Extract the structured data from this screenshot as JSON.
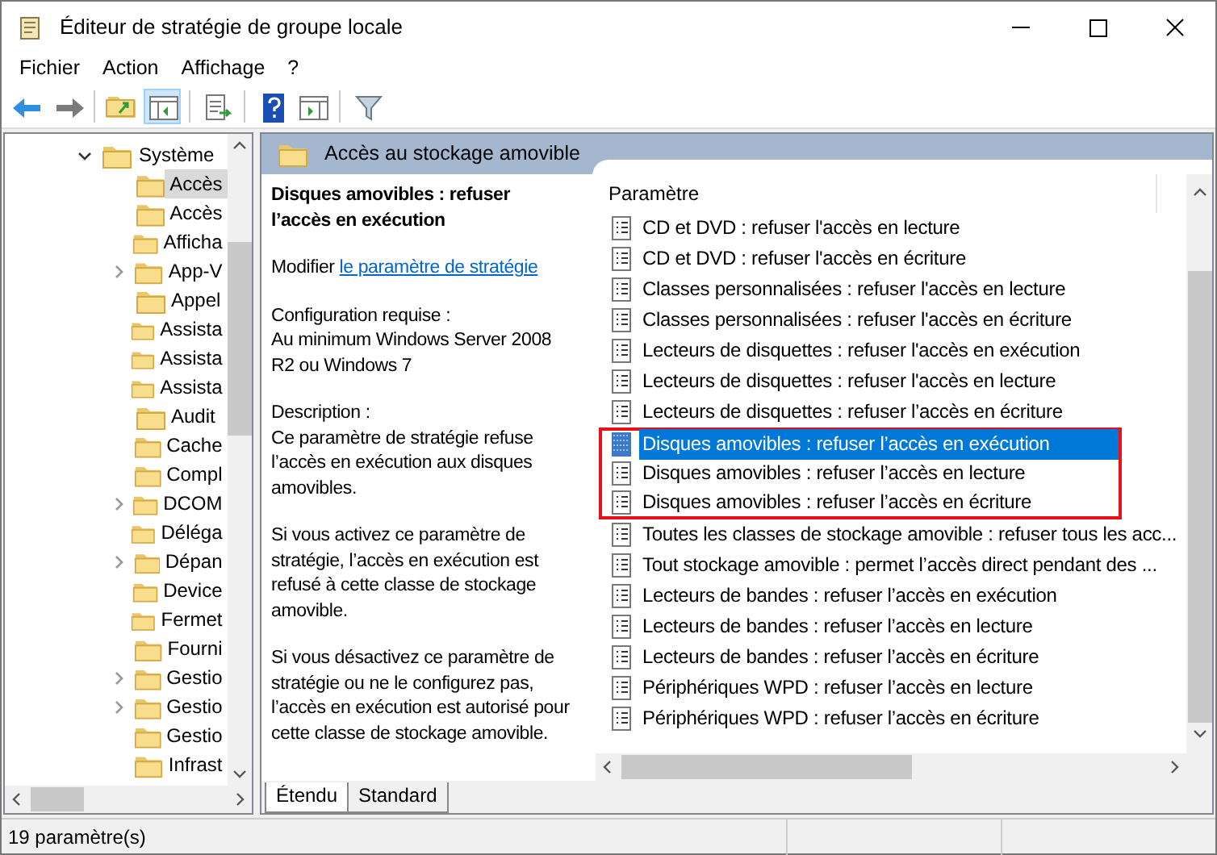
{
  "window": {
    "title": "Éditeur de stratégie de groupe locale"
  },
  "menu": [
    "Fichier",
    "Action",
    "Affichage",
    "?"
  ],
  "tree": {
    "items": [
      {
        "label": "Système",
        "expanded": true,
        "children": [
          {
            "label": "Accès",
            "selected": true,
            "expandable": false
          },
          {
            "label": "Accès",
            "selected": false,
            "expandable": false
          },
          {
            "label": "Afficha",
            "selected": false,
            "expandable": false
          },
          {
            "label": "App-V",
            "selected": false,
            "expandable": true
          },
          {
            "label": "Appel",
            "selected": false,
            "expandable": false
          },
          {
            "label": "Assista",
            "selected": false,
            "expandable": false
          },
          {
            "label": "Assista",
            "selected": false,
            "expandable": false
          },
          {
            "label": "Assista",
            "selected": false,
            "expandable": false
          },
          {
            "label": "Audit",
            "selected": false,
            "expandable": false
          },
          {
            "label": "Cache",
            "selected": false,
            "expandable": false
          },
          {
            "label": "Compl",
            "selected": false,
            "expandable": false
          },
          {
            "label": "DCOM",
            "selected": false,
            "expandable": true
          },
          {
            "label": "Déléga",
            "selected": false,
            "expandable": false
          },
          {
            "label": "Dépan",
            "selected": false,
            "expandable": true
          },
          {
            "label": "Device",
            "selected": false,
            "expandable": false
          },
          {
            "label": "Fermet",
            "selected": false,
            "expandable": false
          },
          {
            "label": "Fourni",
            "selected": false,
            "expandable": false
          },
          {
            "label": "Gestio",
            "selected": false,
            "expandable": true
          },
          {
            "label": "Gestio",
            "selected": false,
            "expandable": true
          },
          {
            "label": "Gestio",
            "selected": false,
            "expandable": false
          },
          {
            "label": "Infrast",
            "selected": false,
            "expandable": false
          }
        ]
      }
    ]
  },
  "details": {
    "header": "Accès au stockage amovible",
    "title": "Disques amovibles : refuser l’accès en exécution",
    "edit_prefix": "Modifier",
    "edit_link": "le paramètre de stratégie",
    "requirements_label": "Configuration requise :",
    "requirements": "Au minimum Windows Server 2008 R2 ou Windows 7",
    "description_label": "Description :",
    "paragraphs": [
      "Ce paramètre de stratégie refuse l’accès en exécution aux disques amovibles.",
      "Si vous activez ce paramètre de stratégie, l’accès en exécution est refusé à cette classe de stockage amovible.",
      "Si vous désactivez ce paramètre de stratégie ou ne le configurez pas, l’accès en exécution est autorisé pour cette classe de stockage amovible."
    ]
  },
  "list": {
    "column": "Paramètre",
    "rows": [
      {
        "label": "CD et DVD : refuser l'accès en lecture",
        "selected": false,
        "boxed": false
      },
      {
        "label": "CD et DVD : refuser l'accès en écriture",
        "selected": false,
        "boxed": false
      },
      {
        "label": "Classes personnalisées : refuser l'accès en lecture",
        "selected": false,
        "boxed": false
      },
      {
        "label": "Classes personnalisées : refuser l'accès en écriture",
        "selected": false,
        "boxed": false
      },
      {
        "label": "Lecteurs de disquettes : refuser l'accès en exécution",
        "selected": false,
        "boxed": false
      },
      {
        "label": "Lecteurs de disquettes : refuser l'accès en lecture",
        "selected": false,
        "boxed": false
      },
      {
        "label": "Lecteurs de disquettes : refuser l’accès en écriture",
        "selected": false,
        "boxed": false
      },
      {
        "label": "Disques amovibles : refuser l’accès en exécution",
        "selected": true,
        "boxed": true
      },
      {
        "label": "Disques amovibles : refuser l’accès en lecture",
        "selected": false,
        "boxed": true
      },
      {
        "label": "Disques amovibles : refuser l’accès en écriture",
        "selected": false,
        "boxed": true
      },
      {
        "label": "Toutes les classes de stockage amovible : refuser tous les acc...",
        "selected": false,
        "boxed": false
      },
      {
        "label": "Tout stockage amovible : permet l’accès direct pendant des ...",
        "selected": false,
        "boxed": false
      },
      {
        "label": "Lecteurs de bandes : refuser l’accès en exécution",
        "selected": false,
        "boxed": false
      },
      {
        "label": "Lecteurs de bandes : refuser l’accès en lecture",
        "selected": false,
        "boxed": false
      },
      {
        "label": "Lecteurs de bandes : refuser l’accès en écriture",
        "selected": false,
        "boxed": false
      },
      {
        "label": "Périphériques WPD : refuser l’accès en lecture",
        "selected": false,
        "boxed": false
      },
      {
        "label": "Périphériques WPD : refuser l’accès en écriture",
        "selected": false,
        "boxed": false
      }
    ]
  },
  "tabs": [
    {
      "label": "Étendu",
      "selected": true
    },
    {
      "label": "Standard",
      "selected": false
    }
  ],
  "status_bar": "19 paramètre(s)"
}
